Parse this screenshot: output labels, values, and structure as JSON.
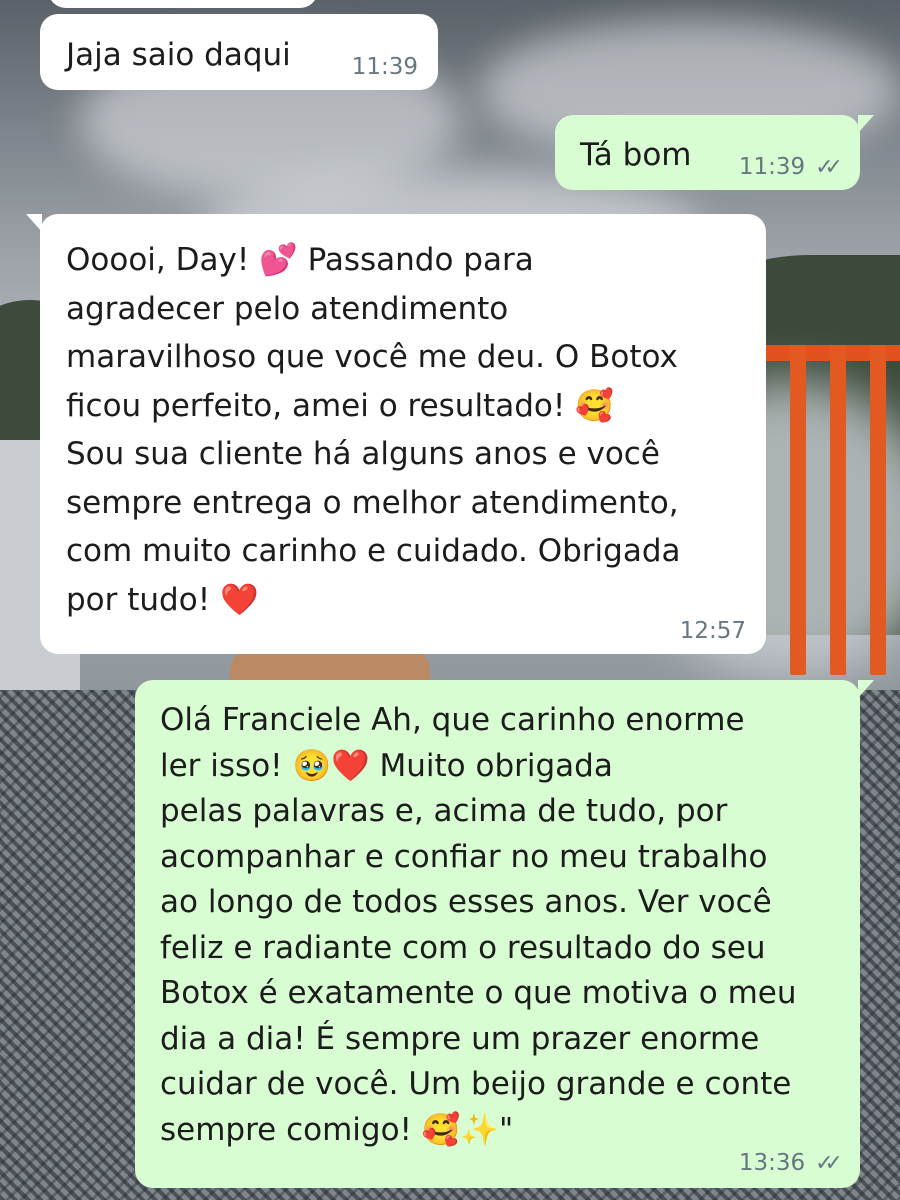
{
  "chat": {
    "messages": [
      {
        "direction": "incoming",
        "text": "Jaja saio daqui",
        "time": "11:39"
      },
      {
        "direction": "outgoing",
        "text": "Tá bom",
        "time": "11:39",
        "status": "read",
        "status_icon": "double-check-icon"
      },
      {
        "direction": "incoming",
        "text": "Ooooi, Day! 💕 Passando para\nagradecer pelo atendimento\nmaravilhoso que você me deu. O Botox\nficou perfeito, amei o resultado! 🥰\nSou sua cliente há alguns anos e você\nsempre entrega o melhor atendimento,\ncom muito carinho e cuidado. Obrigada\npor tudo! ❤️",
        "time": "12:57"
      },
      {
        "direction": "outgoing",
        "text": "Olá Franciele Ah, que carinho enorme\nler isso! 🥹❤️ Muito obrigada\npelas palavras e, acima de tudo, por\nacompanhar e confiar no meu trabalho\nao longo de todos esses anos. Ver você\nfeliz e radiante com o resultado do seu\nBotox é exatamente o que motiva o meu\ndia a dia! É sempre um prazer enorme\ncuidar de você. Um beijo grande e conte\nsempre comigo! 🥰✨\"",
        "time": "13:36",
        "status": "read",
        "status_icon": "double-check-icon"
      }
    ]
  },
  "colors": {
    "incoming_bubble": "#ffffff",
    "outgoing_bubble": "#d9fdd3",
    "timestamp": "#667781"
  }
}
